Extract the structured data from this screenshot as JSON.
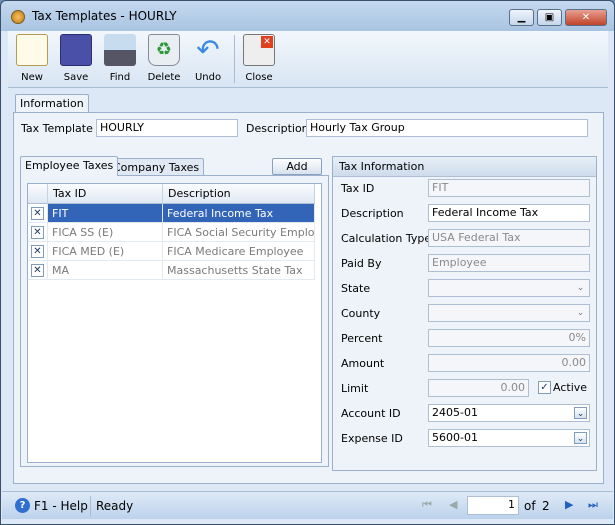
{
  "window": {
    "title": "Tax Templates - HOURLY"
  },
  "toolbar": {
    "new": "New",
    "save": "Save",
    "find": "Find",
    "delete": "Delete",
    "undo": "Undo",
    "close": "Close"
  },
  "tabs": {
    "information": "Information"
  },
  "header": {
    "tax_template_label": "Tax Template",
    "tax_template_value": "HOURLY",
    "description_label": "Description",
    "description_value": "Hourly Tax Group"
  },
  "subtabs": {
    "employee": "Employee Taxes",
    "company": "Company Taxes",
    "add": "Add"
  },
  "grid": {
    "columns": [
      "Tax ID",
      "Description"
    ],
    "rows": [
      {
        "id": "FIT",
        "description": "Federal Income Tax",
        "selected": true
      },
      {
        "id": "FICA SS (E)",
        "description": "FICA Social Security Employee"
      },
      {
        "id": "FICA MED (E)",
        "description": "FICA Medicare Employee"
      },
      {
        "id": "MA",
        "description": "Massachusetts State Tax"
      }
    ]
  },
  "tax_info": {
    "title": "Tax Information",
    "tax_id_label": "Tax ID",
    "tax_id": "FIT",
    "description_label": "Description",
    "description": "Federal Income Tax",
    "calc_type_label": "Calculation Type",
    "calc_type": "USA Federal Tax",
    "paid_by_label": "Paid By",
    "paid_by": "Employee",
    "state_label": "State",
    "state": "",
    "county_label": "County",
    "county": "",
    "percent_label": "Percent",
    "percent": "0%",
    "amount_label": "Amount",
    "amount": "0.00",
    "limit_label": "Limit",
    "limit": "0.00",
    "active_label": "Active",
    "active": true,
    "account_id_label": "Account ID",
    "account_id": "2405-01",
    "expense_id_label": "Expense ID",
    "expense_id": "5600-01"
  },
  "status": {
    "help": "F1 - Help",
    "state": "Ready",
    "page": "1",
    "of_label": "of",
    "total_pages": "2"
  }
}
